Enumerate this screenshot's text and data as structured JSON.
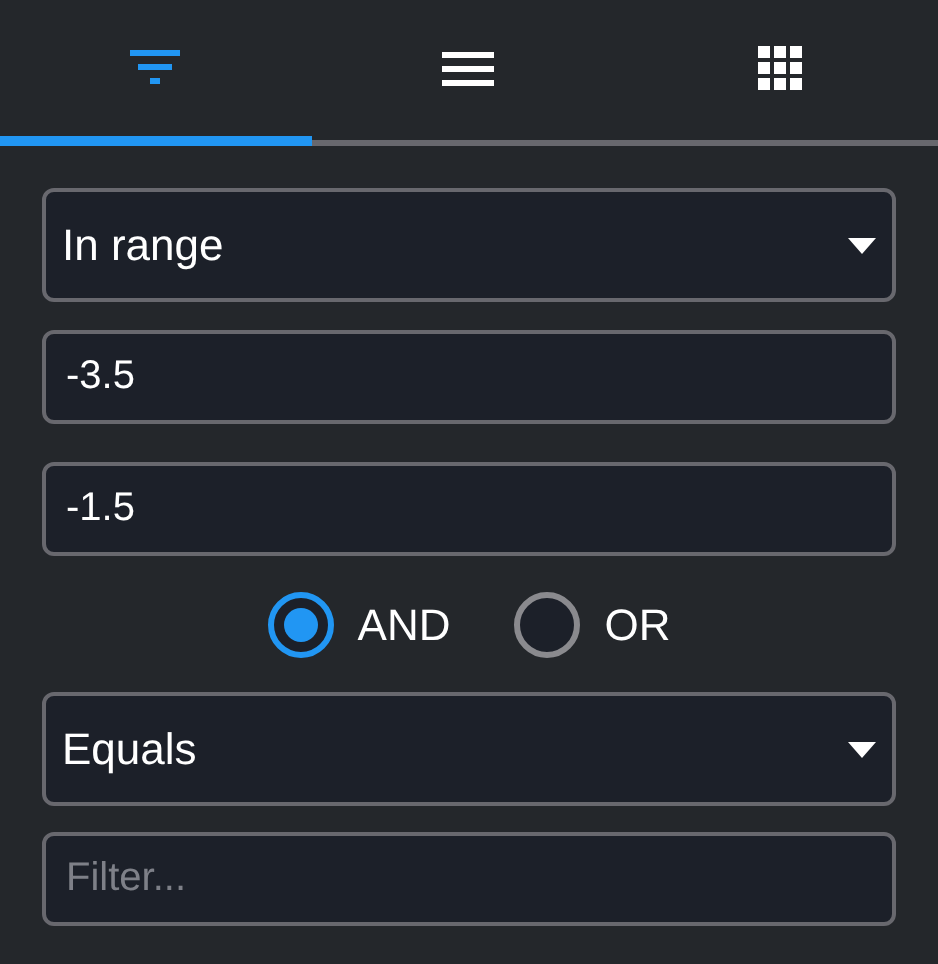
{
  "tabs": [
    {
      "kind": "filter",
      "selected": true
    },
    {
      "kind": "menu",
      "selected": false
    },
    {
      "kind": "grid",
      "selected": false
    }
  ],
  "condition_1": {
    "operator": "In range",
    "value_from": "-3.5",
    "value_to": "-1.5"
  },
  "join": [
    {
      "label": "AND",
      "selected": true
    },
    {
      "label": "OR",
      "selected": false
    }
  ],
  "condition_2": {
    "operator": "Equals",
    "placeholder": "Filter..."
  }
}
